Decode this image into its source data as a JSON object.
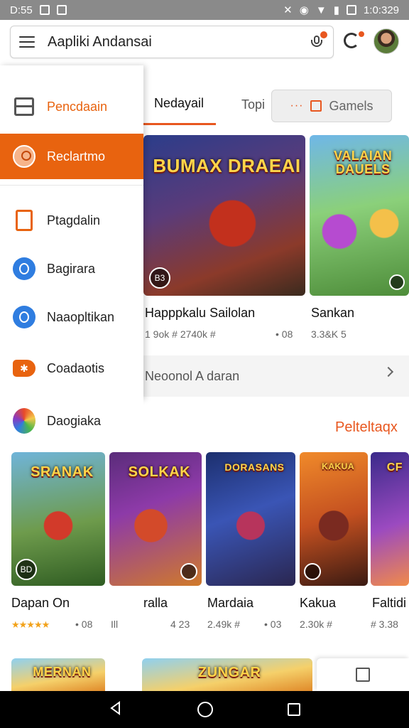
{
  "status_bar": {
    "time_left": "D:55",
    "time_right": "1:0:329"
  },
  "search": {
    "text": "Aapliki Andansai"
  },
  "drawer": {
    "items": [
      {
        "label": "Pencdaain",
        "icon": "layout-icon"
      },
      {
        "label": "Reclartmo",
        "icon": "person-icon",
        "active": true
      },
      {
        "label": "Ptagdalin",
        "icon": "document-icon"
      },
      {
        "label": "Bagirara",
        "icon": "circle-d-icon"
      },
      {
        "label": "Naaopltikan",
        "icon": "circle-o-icon"
      },
      {
        "label": "Coadaotis",
        "icon": "tag-icon"
      }
    ],
    "section_label": "Daogiaka"
  },
  "tabs": [
    {
      "label": "Nedayail",
      "active": true
    },
    {
      "label": "Topi"
    },
    {
      "label": "Gamels",
      "prefix": "···"
    }
  ],
  "featured": [
    {
      "art_title": "BUMAX DRAEAI",
      "badge": "B3",
      "title": "Happpkalu Sailolan",
      "meta": "1 9ok # 2740k #",
      "meta2": "• 08"
    },
    {
      "art_title": "VALAIAN DAUELS",
      "badge": "",
      "title": "Sankan",
      "meta": "3.3&K 5"
    }
  ],
  "row_link": {
    "label": "Neoonol A daran"
  },
  "section_right": "Pelteltaqx",
  "games": [
    {
      "art_title": "SRANAK",
      "badge": "BD",
      "title": "Dapan On",
      "meta": "• 08",
      "stars": "★★★★★"
    },
    {
      "art_title": "SOLKAK",
      "badge": "",
      "title": "ralla",
      "meta": "4 23",
      "meta_left": "Ill"
    },
    {
      "art_title": "DORASANS",
      "badge": "",
      "title": "Mardaia",
      "meta": "2.49k #",
      "meta2": "• 03"
    },
    {
      "art_title": "KAKUA",
      "badge": "",
      "title": "Kakua",
      "meta": "2.30k #"
    },
    {
      "art_title": "CF",
      "badge": "",
      "title": "Faltidi",
      "meta": "# 3.38"
    }
  ],
  "bottom_row": [
    {
      "art_title": "MERNAN"
    },
    {
      "art_title": "ZUNGAR"
    }
  ],
  "colors": {
    "accent": "#e8630f",
    "status_bar": "#8a8a8a",
    "nav_bar": "#000000"
  }
}
